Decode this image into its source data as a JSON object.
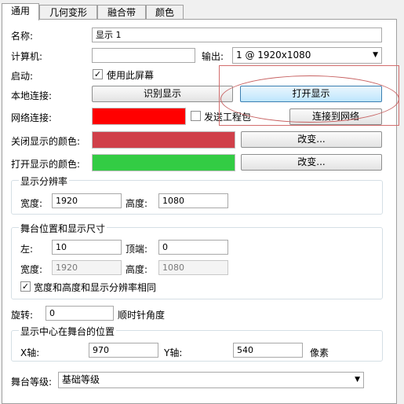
{
  "tabs": [
    {
      "label": "通用"
    },
    {
      "label": "几何变形"
    },
    {
      "label": "融合带"
    },
    {
      "label": "颜色"
    }
  ],
  "general": {
    "name_label": "名称:",
    "name_value": "显示 1",
    "computer_label": "计算机:",
    "computer_value": "",
    "output_label": "输出:",
    "output_value": "1 @ 1920x1080",
    "startup_label": "启动:",
    "use_screen_label": "使用此屏幕",
    "use_screen_checked": true,
    "local_label": "本地连接:",
    "identify_btn": "识别显示",
    "open_btn": "打开显示",
    "network_label": "网络连接:",
    "network_color": "#ff0000",
    "send_packet_label": "发送工程包",
    "send_packet_checked": false,
    "connect_btn": "连接到网络",
    "off_color_label": "关闭显示的颜色:",
    "off_color": "#d0404a",
    "change_btn_1": "改变...",
    "on_color_label": "打开显示的颜色:",
    "on_color": "#33cc44",
    "change_btn_2": "改变..."
  },
  "resolution": {
    "title": "显示分辨率",
    "width_label": "宽度:",
    "width_value": "1920",
    "height_label": "高度:",
    "height_value": "1080"
  },
  "stage": {
    "title": "舞台位置和显示尺寸",
    "left_label": "左:",
    "left_value": "10",
    "top_label": "顶端:",
    "top_value": "0",
    "width_label": "宽度:",
    "width_value": "1920",
    "height_label": "高度:",
    "height_value": "1080",
    "same_label": "宽度和高度和显示分辨率相同",
    "same_checked": true
  },
  "rotation": {
    "label": "旋转:",
    "value": "0",
    "unit": "顺时针角度"
  },
  "center": {
    "title": "显示中心在舞台的位置",
    "x_label": "X轴:",
    "x_value": "970",
    "y_label": "Y轴:",
    "y_value": "540",
    "unit": "像素"
  },
  "level": {
    "label": "舞台等级:",
    "value": "基础等级"
  }
}
